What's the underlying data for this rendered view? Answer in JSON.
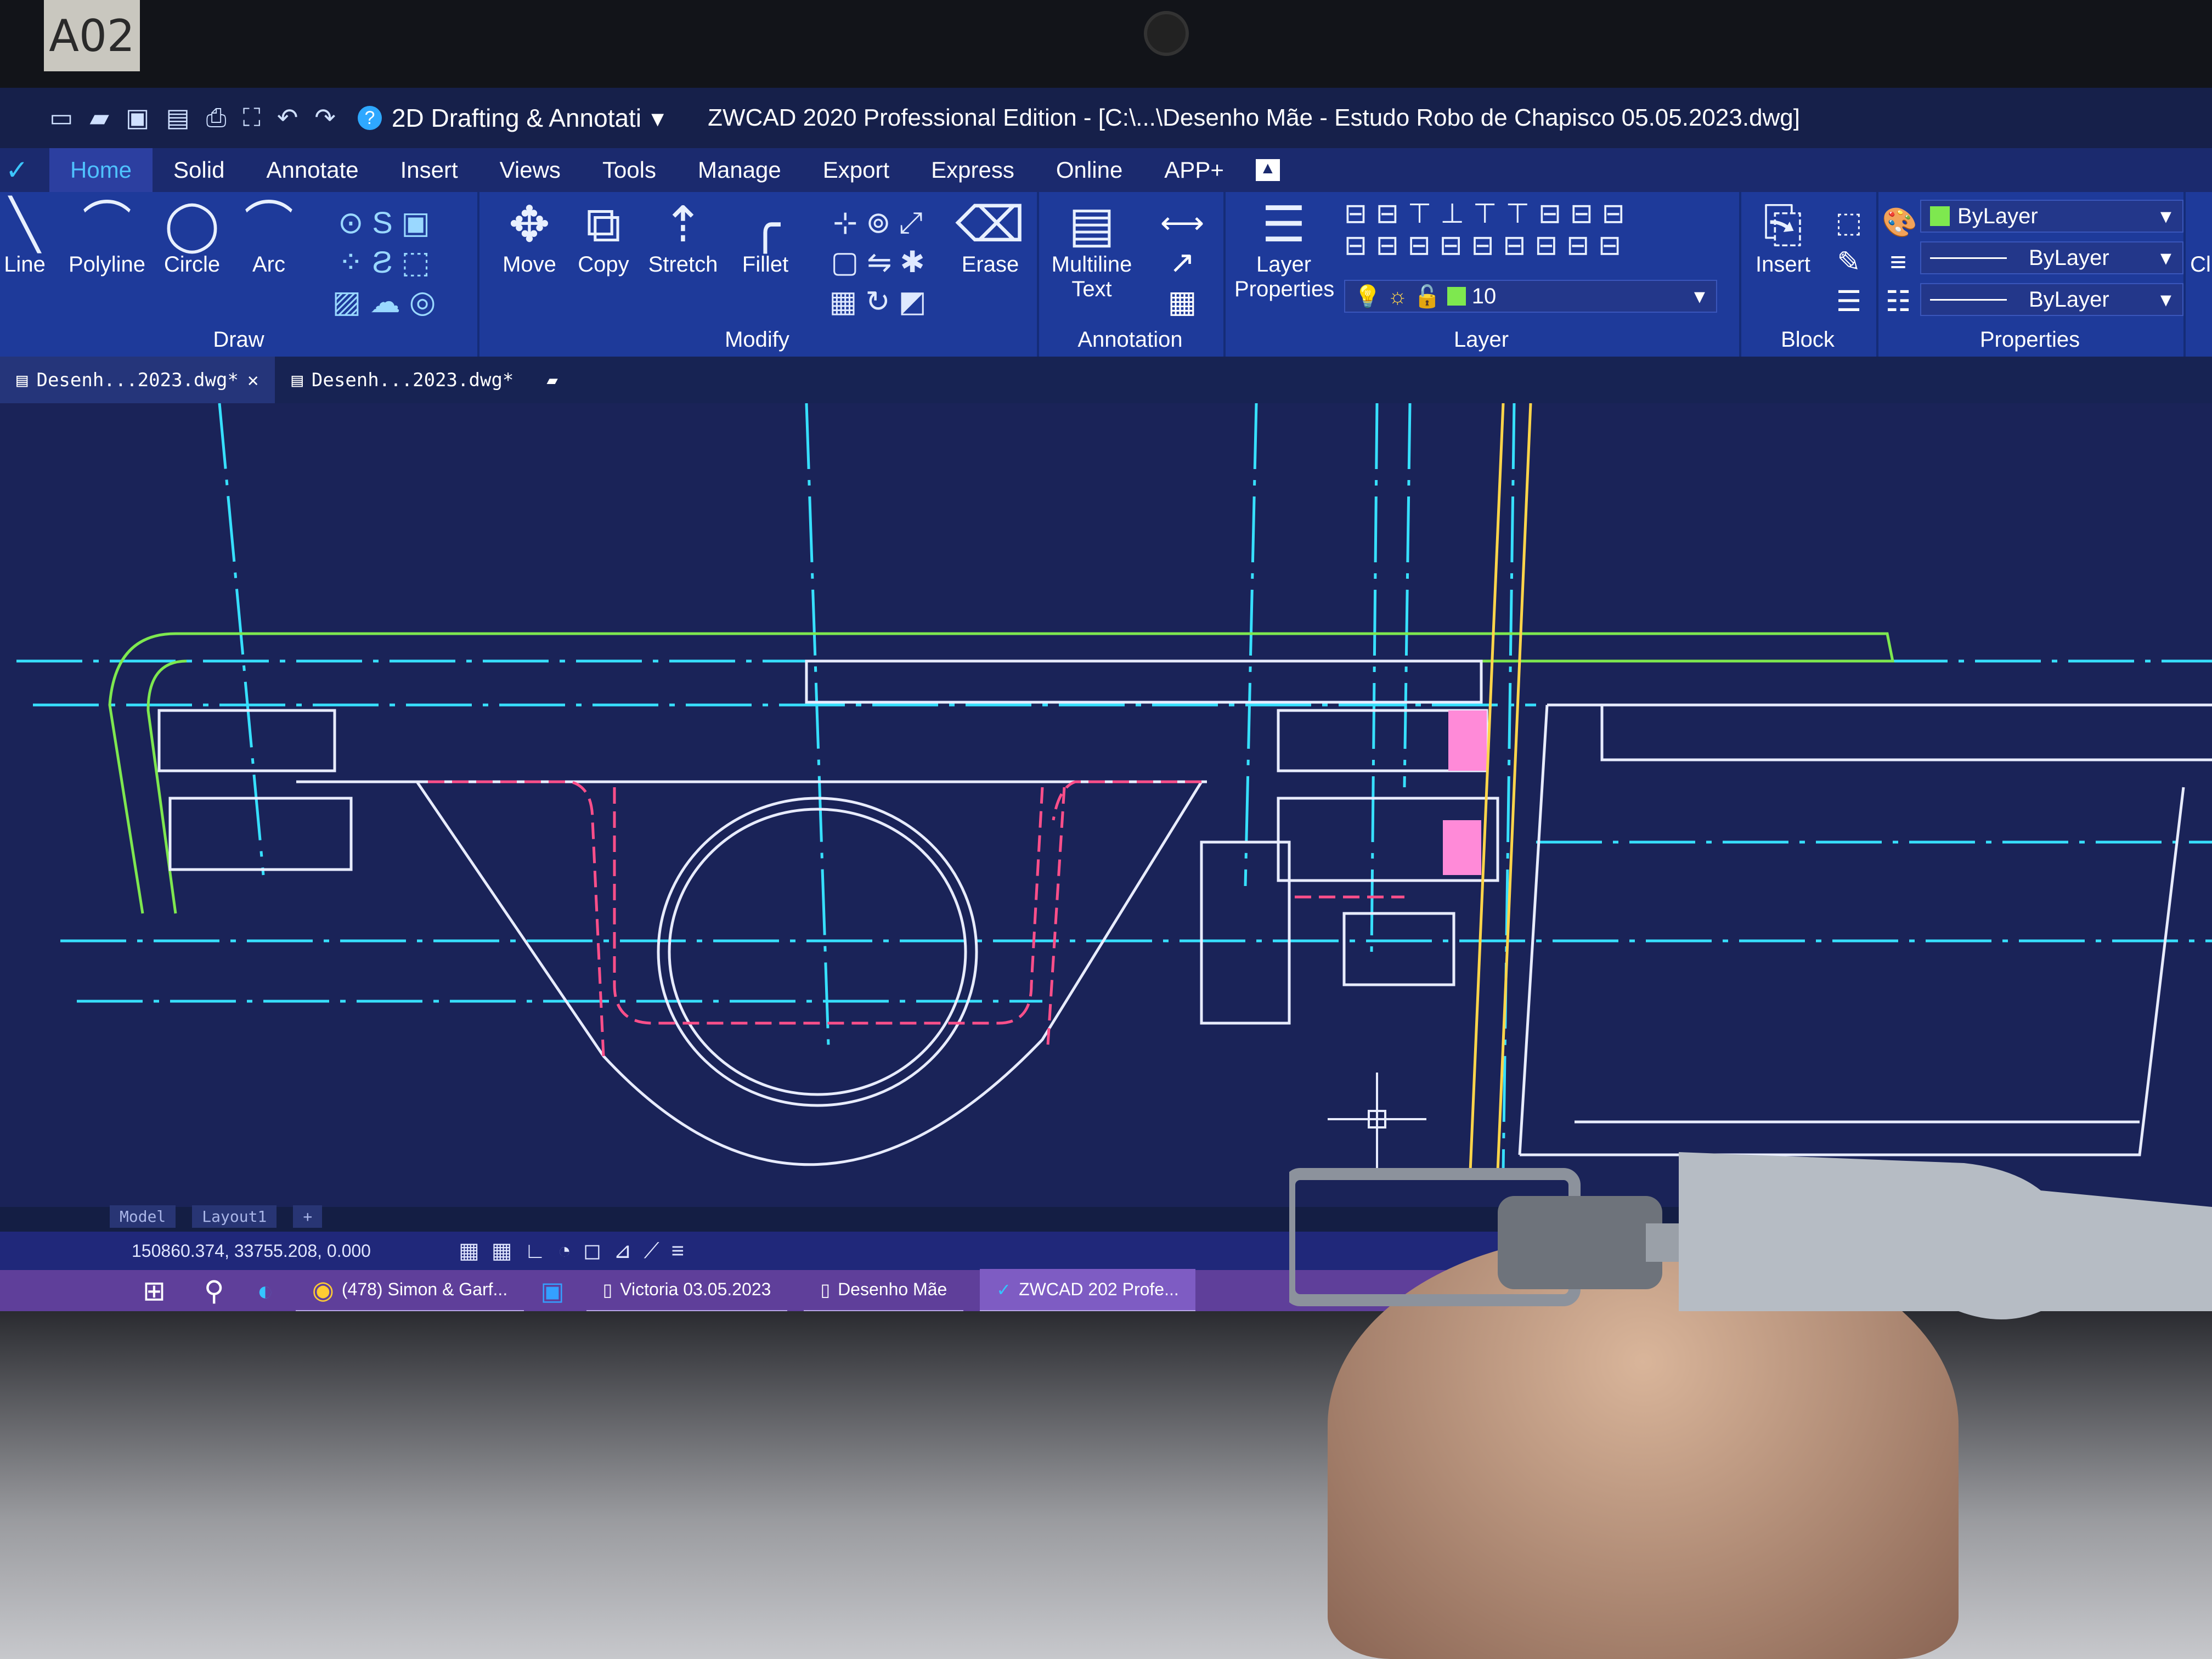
{
  "sticker_label": "A02",
  "titlebar": {
    "workspace": "2D Drafting & Annotati",
    "title": "ZWCAD 2020 Professional Edition - [C:\\...\\Desenho Mãe - Estudo Robo de Chapisco 05.05.2023.dwg]"
  },
  "menu_tabs": [
    "Home",
    "Solid",
    "Annotate",
    "Insert",
    "Views",
    "Tools",
    "Manage",
    "Export",
    "Express",
    "Online",
    "APP+"
  ],
  "ribbon": {
    "draw": {
      "label": "Draw",
      "line": "Line",
      "polyline": "Polyline",
      "circle": "Circle",
      "arc": "Arc"
    },
    "modify": {
      "label": "Modify",
      "move": "Move",
      "copy": "Copy",
      "stretch": "Stretch",
      "fillet": "Fillet",
      "erase": "Erase"
    },
    "annotation": {
      "label": "Annotation",
      "mtext_line1": "Multiline",
      "mtext_line2": "Text"
    },
    "layer": {
      "label": "Layer",
      "props_line1": "Layer",
      "props_line2": "Properties",
      "current": "10"
    },
    "block": {
      "label": "Block",
      "insert": "Insert"
    },
    "properties": {
      "label": "Properties",
      "color": "ByLayer",
      "linetype": "ByLayer",
      "lineweight": "ByLayer"
    },
    "clip": "Cl"
  },
  "doc_tabs": [
    "Desenh...2023.dwg*",
    "Desenh...2023.dwg*"
  ],
  "layout_tabs": [
    "Model",
    "Layout1",
    "+"
  ],
  "status": {
    "coords": "150860.374, 33755.208, 0.000"
  },
  "taskbar": [
    "(478) Simon & Garf...",
    "Victoria 03.05.2023",
    "Desenho Mãe",
    "ZWCAD 202 Profe..."
  ],
  "colors": {
    "ribbon": "#1e3a9a",
    "canvas": "#1a2358",
    "cyan_line": "#37e0ff",
    "green_line": "#7ee84f",
    "pink_line": "#ff4f8a",
    "white_line": "#e8ecff",
    "yellow_line": "#ffd54a"
  }
}
